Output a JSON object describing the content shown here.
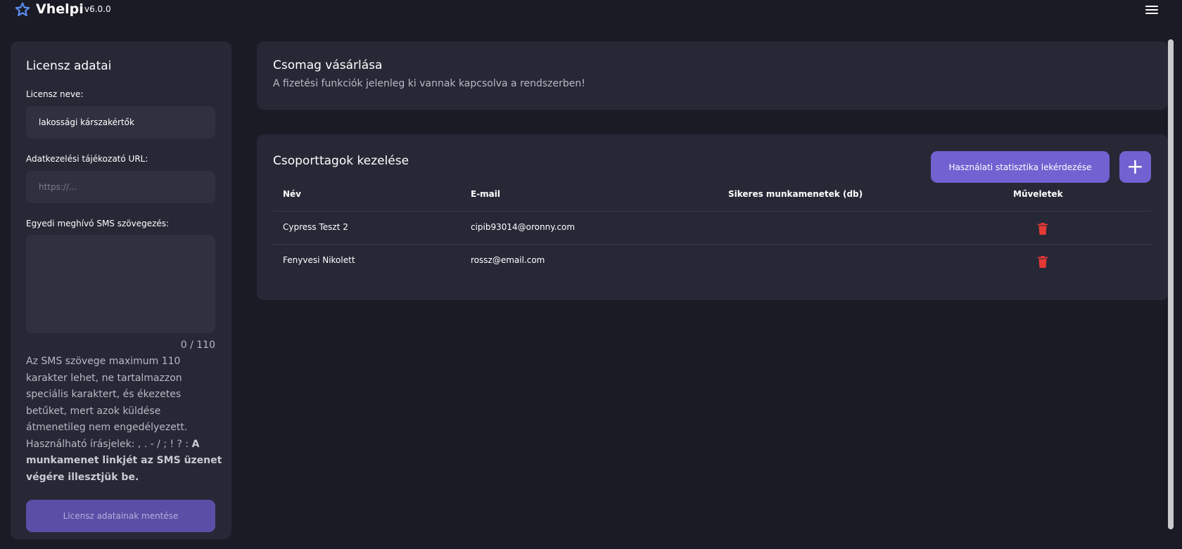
{
  "header": {
    "app_name": "Vhelpi",
    "version": "v6.0.0",
    "logo_icon": "star-outline-icon",
    "menu_icon": "hamburger-menu-icon"
  },
  "license": {
    "title": "Licensz adatai",
    "name_label": "Licensz neve:",
    "name_value": "lakossági kárszakértők",
    "url_label": "Adatkezelési tájékozató URL:",
    "url_placeholder": "https://...",
    "url_value": "",
    "sms_label": "Egyedi meghívó SMS szövegezés:",
    "sms_value": "",
    "char_count": "0 / 110",
    "help_text": "Az SMS szövege maximum 110 karakter lehet, ne tartalmazzon speciális karaktert, és ékezetes betűket, mert azok küldése átmenetileg nem engedélyezett. Használható írásjelek: , . - / ; ! ? :",
    "help_bold": "A munkamenet linkjét az SMS üzenet végére illesztjük be.",
    "save_label": "Licensz adatainak mentése"
  },
  "purchase": {
    "title": "Csomag vásárlása",
    "subtitle": "A fizetési funkciók jelenleg ki vannak kapcsolva a rendszerben!"
  },
  "members": {
    "title": "Csoporttagok kezelése",
    "stats_button": "Használati statisztika lekérdezése",
    "add_button": "+",
    "columns": [
      "Név",
      "E-mail",
      "Sikeres munkamenetek (db)",
      "Műveletek"
    ],
    "rows": [
      {
        "name": "Cypress Teszt 2",
        "email": "cipib93014@oronny.com",
        "sessions": "",
        "action_icon": "trash-icon"
      },
      {
        "name": "Fenyvesi Nikolett",
        "email": "rossz@email.com",
        "sessions": "",
        "action_icon": "trash-icon"
      }
    ]
  },
  "colors": {
    "background": "#1b1b26",
    "card": "#272836",
    "input": "#30313f",
    "accent": "#7161d1",
    "accent_disabled": "#5a4fa6",
    "danger": "#e53935",
    "logo": "#5b8ff0"
  }
}
